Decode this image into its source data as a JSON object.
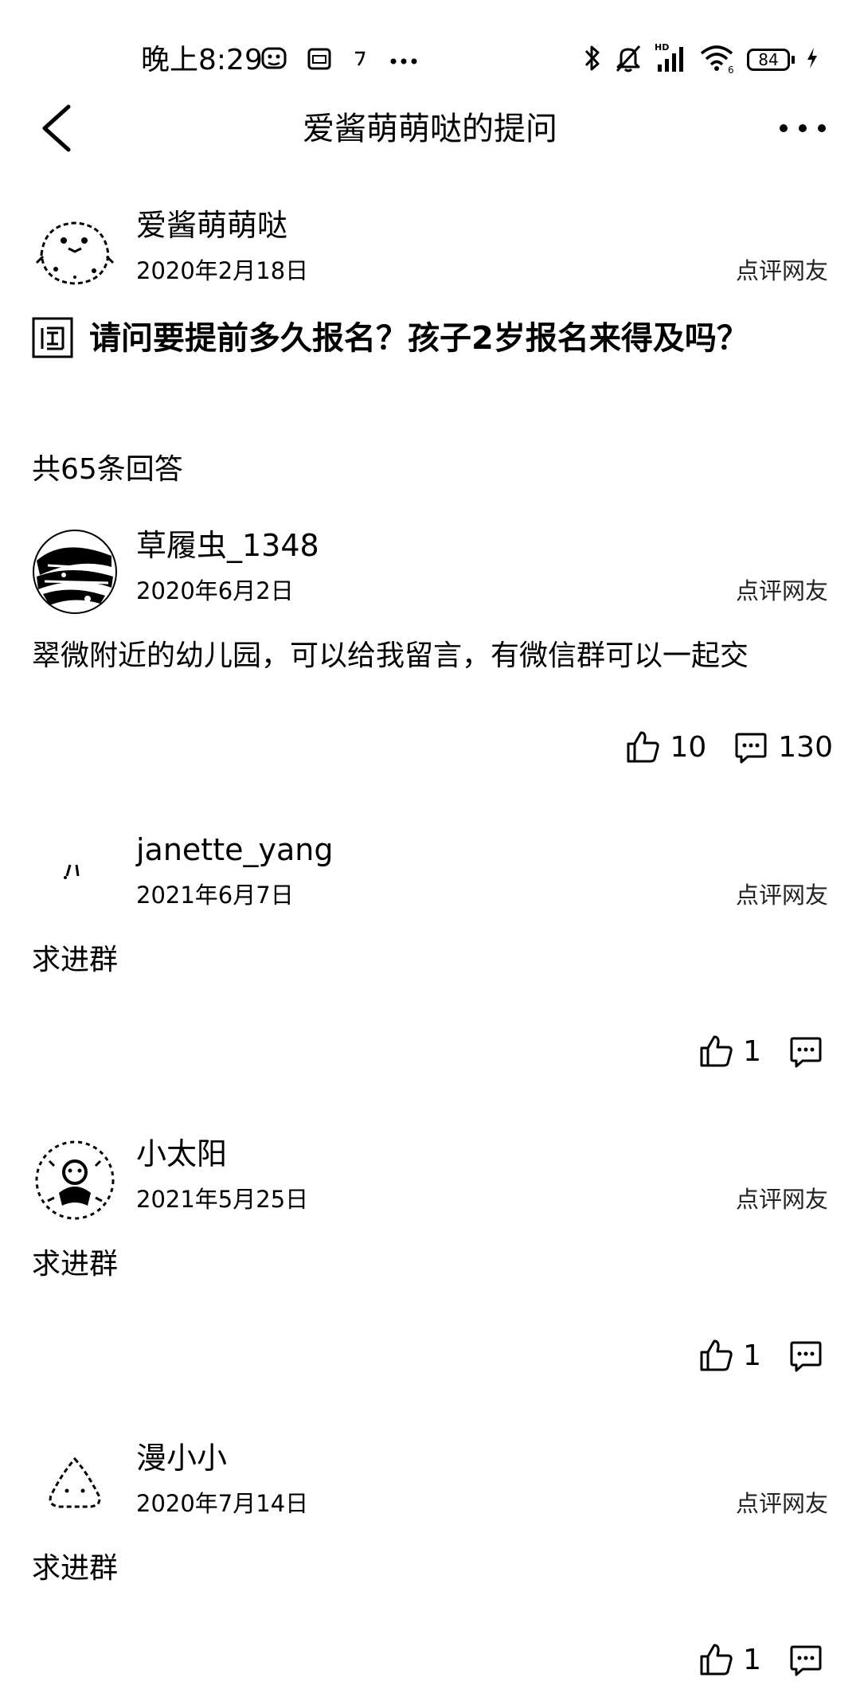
{
  "status_bar": {
    "time": "晚上8:29",
    "left_icons": [
      "app-notification-icon",
      "photo-icon",
      "hook-icon",
      "more-dots-icon"
    ],
    "right_icons": [
      "bluetooth-icon",
      "mute-icon",
      "hd-signal-icon",
      "wifi-icon",
      "battery-icon",
      "charging-icon"
    ],
    "hd_label": "HD",
    "wifi_gen": "6",
    "battery": "84"
  },
  "nav": {
    "title": "爱酱萌萌哒的提问"
  },
  "question": {
    "user": "爱酱萌萌哒",
    "date": "2020年2月18日",
    "user_type": "点评网友",
    "text": "请问要提前多久报名？孩子2岁报名来得及吗？"
  },
  "answer_count": "共65条回答",
  "answers": [
    {
      "user": "草履虫_1348",
      "date": "2020年6月2日",
      "user_type": "点评网友",
      "content": "翠微附近的幼儿园，可以给我留言，有微信群可以一起交",
      "likes": "10",
      "comments": "130"
    },
    {
      "user": "janette_yang",
      "date": "2021年6月7日",
      "user_type": "点评网友",
      "content": "求进群",
      "likes": "1",
      "comments": ""
    },
    {
      "user": "小太阳",
      "date": "2021年5月25日",
      "user_type": "点评网友",
      "content": "求进群",
      "likes": "1",
      "comments": ""
    },
    {
      "user": "漫小小",
      "date": "2020年7月14日",
      "user_type": "点评网友",
      "content": "求进群",
      "likes": "1",
      "comments": ""
    }
  ]
}
